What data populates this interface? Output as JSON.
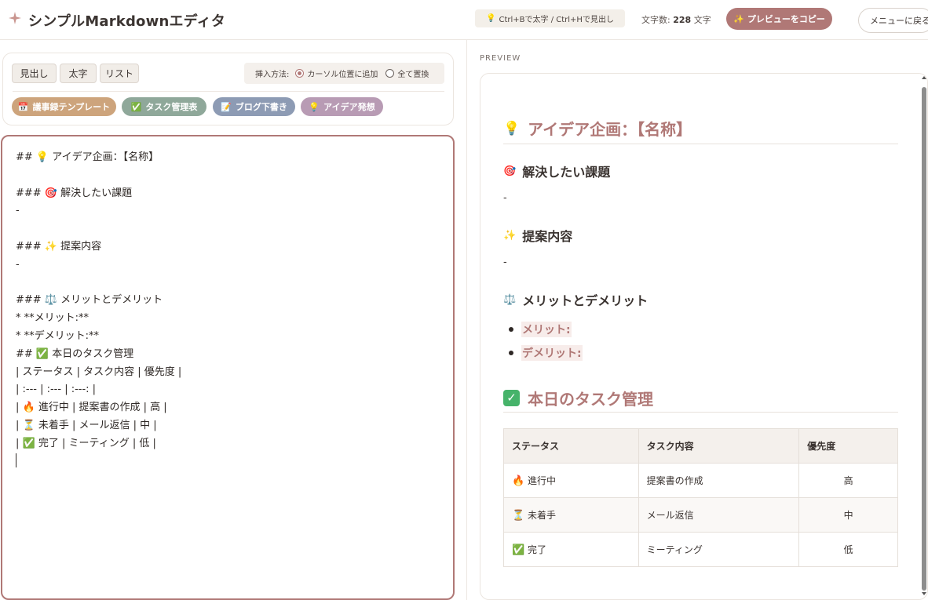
{
  "header": {
    "logo_icon": "sparkle-icon",
    "title": "シンプルMarkdownエディタ",
    "shortcut_icon": "💡",
    "shortcut_hint": "Ctrl+Bで太字 / Ctrl+Hで見出し",
    "char_count_label": "文字数:",
    "char_count_value": "228",
    "char_count_unit": "文字",
    "copy_icon": "✨",
    "copy_label": "プレビューをコピー",
    "back_label": "メニューに戻る"
  },
  "toolbar": {
    "heading_label": "見出し",
    "bold_label": "太字",
    "list_label": "リスト",
    "insert_mode_label": "挿入方法:",
    "insert_options": [
      "カーソル位置に追加",
      "全て置換"
    ],
    "insert_selected": "カーソル位置に追加",
    "templates": [
      {
        "icon": "📅",
        "label": "議事録テンプレート",
        "color": "#cda47c"
      },
      {
        "icon": "✅",
        "label": "タスク管理表",
        "color": "#8fa89a"
      },
      {
        "icon": "📝",
        "label": "ブログ下書き",
        "color": "#8d9bb4"
      },
      {
        "icon": "💡",
        "label": "アイデア発想",
        "color": "#b89bb4"
      }
    ]
  },
  "editor": {
    "lines": [
      "## 💡 アイデア企画：【名称】",
      "",
      "### 🎯 解決したい課題",
      "-",
      "",
      "### ✨ 提案内容",
      "-",
      "",
      "### ⚖️ メリットとデメリット",
      "* **メリット:**",
      "* **デメリット:**",
      "## ✅ 本日のタスク管理",
      "| ステータス | タスク内容 | 優先度 |",
      "| :--- | :--- | :---: |",
      "| 🔥 進行中 | 提案書の作成 | 高 |",
      "| ⏳ 未着手 | メール返信 | 中 |",
      "| ✅ 完了 | ミーティング | 低 |",
      ""
    ]
  },
  "preview": {
    "label": "PREVIEW",
    "h2_idea_icon": "💡",
    "h2_idea": "アイデア企画：【名称】",
    "h3_problem_icon": "🎯",
    "h3_problem": "解決したい課題",
    "problem_text": "-",
    "h3_proposal_icon": "✨",
    "h3_proposal": "提案内容",
    "proposal_text": "-",
    "h3_merit_icon": "⚖️",
    "h3_merit": "メリットとデメリット",
    "merit_items": [
      "メリット:",
      "デメリット:"
    ],
    "h2_task": "本日のタスク管理",
    "table": {
      "headers": [
        "ステータス",
        "タスク内容",
        "優先度"
      ],
      "rows": [
        {
          "icon": "🔥",
          "status": "進行中",
          "task": "提案書の作成",
          "priority": "高"
        },
        {
          "icon": "⏳",
          "status": "未着手",
          "task": "メール返信",
          "priority": "中"
        },
        {
          "icon": "✅",
          "status": "完了",
          "task": "ミーティング",
          "priority": "低"
        }
      ]
    }
  },
  "colors": {
    "accent": "#b07876",
    "editor_border": "#b07876"
  }
}
